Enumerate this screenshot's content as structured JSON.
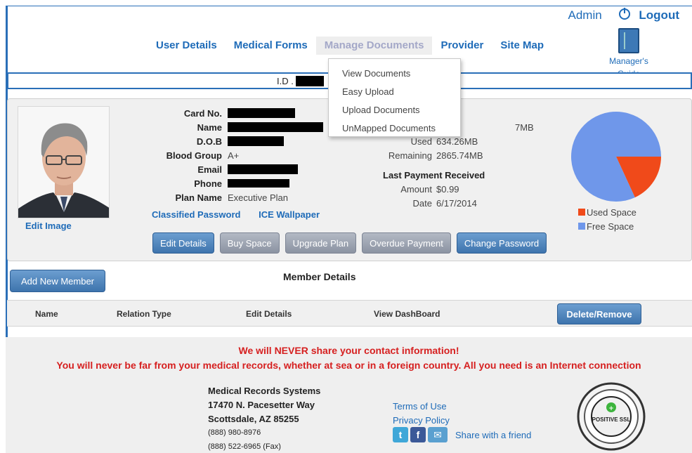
{
  "header": {
    "admin": "Admin",
    "logout": "Logout",
    "guide_label": "Manager's Guide"
  },
  "nav": {
    "items": [
      "User Details",
      "Medical Forms",
      "Manage Documents",
      "Provider",
      "Site Map"
    ],
    "active_index": 2
  },
  "dropdown": {
    "items": [
      "View Documents",
      "Easy Upload",
      "Upload Documents",
      "UnMapped Documents"
    ]
  },
  "id_bar": {
    "label": "I.D ."
  },
  "profile": {
    "edit_image": "Edit Image",
    "fields": [
      {
        "label": "Card No.",
        "value": ""
      },
      {
        "label": "Name",
        "value": ""
      },
      {
        "label": "D.O.B",
        "value": ""
      },
      {
        "label": "Blood Group",
        "value": "A+"
      },
      {
        "label": "Email",
        "value": ""
      },
      {
        "label": "Phone",
        "value": ""
      },
      {
        "label": "Plan Name",
        "value": "Executive Plan"
      }
    ],
    "links": [
      "Classified Password",
      "ICE Wallpaper"
    ],
    "storage": {
      "total_value": "7MB",
      "used_label": "Used",
      "used_value": "634.26MB",
      "remaining_label": "Remaining",
      "remaining_value": "2865.74MB"
    },
    "payment": {
      "title": "Last Payment Received",
      "amount_label": "Amount",
      "amount_value": "$0.99",
      "date_label": "Date",
      "date_value": "6/17/2014"
    },
    "buttons": [
      "Edit Details",
      "Buy Space",
      "Upgrade Plan",
      "Overdue Payment",
      "Change Password"
    ]
  },
  "chart_data": {
    "type": "pie",
    "labels": [
      "Used Space",
      "Free Space"
    ],
    "values": [
      634.26,
      2865.74
    ],
    "colors": [
      "#f04a1a",
      "#6f97ea"
    ],
    "legend": "bottom"
  },
  "members": {
    "add_button": "Add New Member",
    "title": "Member Details",
    "columns": [
      "Name",
      "Relation Type",
      "Edit Details",
      "View DashBoard"
    ],
    "delete_button": "Delete/Remove"
  },
  "footer": {
    "warning1": "We will NEVER share your contact information!",
    "warning2": "You will never be far from your medical records, whether at sea or in a foreign country. All you need is an Internet connection",
    "address": [
      "Medical Records Systems",
      "17470 N. Pacesetter Way",
      "Scottsdale, AZ 85255",
      "(888) 980-8976",
      "(888) 522-6965 (Fax)"
    ],
    "links": [
      "Terms of Use",
      "Privacy Policy"
    ],
    "share": "Share with a friend",
    "ssl_label": "POSITIVE SSL"
  },
  "colors": {
    "accent": "#1e6bb8",
    "warning": "#d62020"
  }
}
